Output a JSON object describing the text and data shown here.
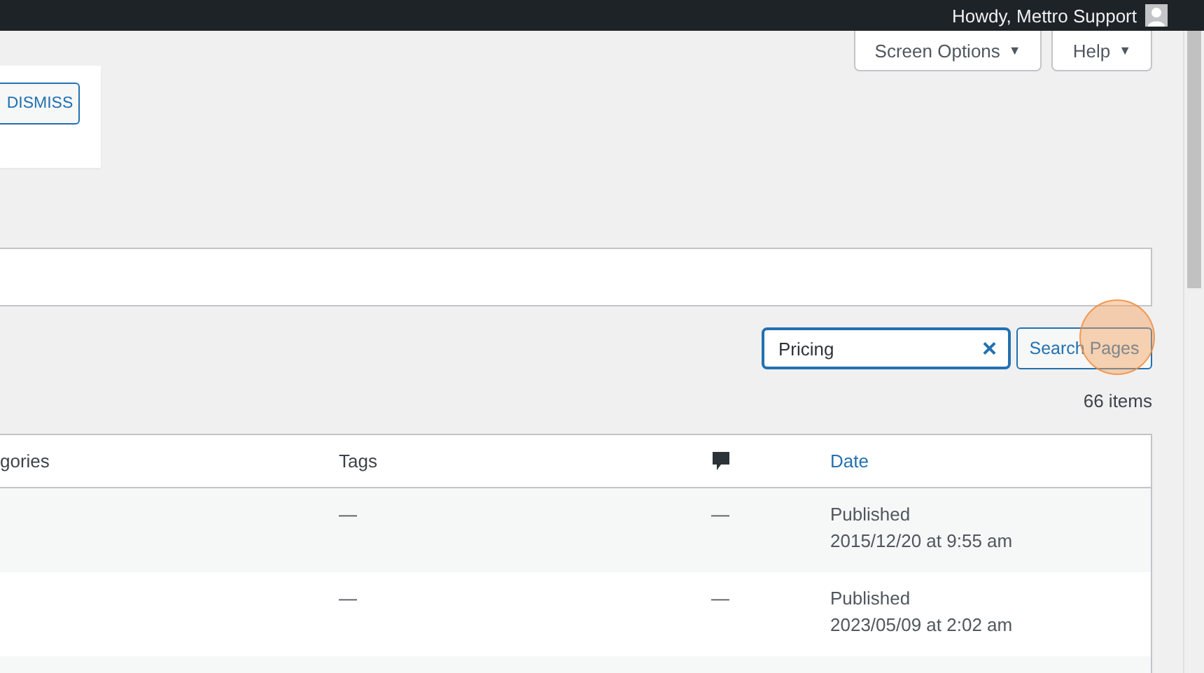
{
  "admin_bar": {
    "greeting": "Howdy, Mettro Support"
  },
  "screen_meta": [
    {
      "label": "Screen Options",
      "caret": "▼"
    },
    {
      "label": "Help",
      "caret": "▼"
    }
  ],
  "notice": {
    "button": "DISMISS"
  },
  "search": {
    "value": "Pricing",
    "clear": "×",
    "button": "Search Pages"
  },
  "item_count": "66 items",
  "table": {
    "columns": [
      {
        "label": "gories",
        "kind": "text"
      },
      {
        "label": "Tags",
        "kind": "text"
      },
      {
        "kind": "comments"
      },
      {
        "label": "Date",
        "kind": "link"
      }
    ],
    "rows": [
      {
        "cells": [
          "",
          "—",
          "—",
          [
            "Published",
            "2015/12/20 at 9:55 am"
          ]
        ]
      },
      {
        "cells": [
          "",
          "—",
          "—",
          [
            "Published",
            "2023/05/09 at 2:02 am"
          ]
        ]
      }
    ]
  }
}
